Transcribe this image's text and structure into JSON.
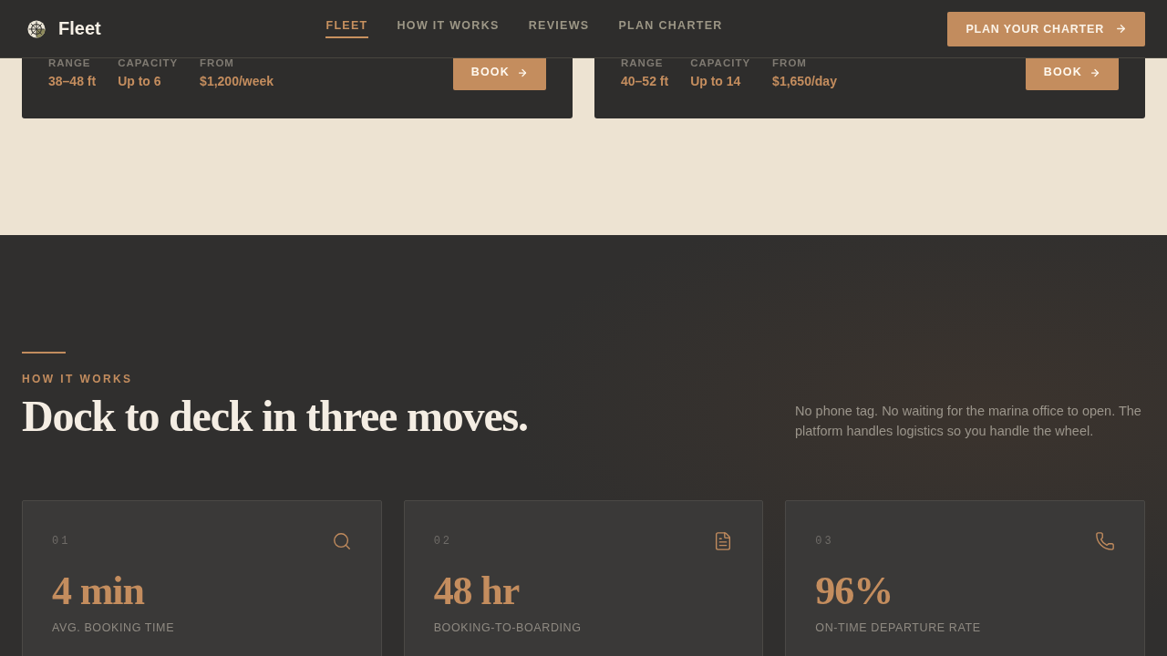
{
  "header": {
    "brand": "Fleet",
    "nav": [
      {
        "label": "FLEET",
        "selected": true
      },
      {
        "label": "HOW IT WORKS",
        "selected": false
      },
      {
        "label": "REVIEWS",
        "selected": false
      },
      {
        "label": "PLAN CHARTER",
        "selected": false
      }
    ],
    "cta": "PLAN YOUR CHARTER"
  },
  "fleet_cards": [
    {
      "specs": [
        {
          "label": "RANGE",
          "value": "38–48 ft"
        },
        {
          "label": "CAPACITY",
          "value": "Up to 6"
        },
        {
          "label": "FROM",
          "value": "$1,200/week"
        }
      ],
      "button": "BOOK"
    },
    {
      "specs": [
        {
          "label": "RANGE",
          "value": "40–52 ft"
        },
        {
          "label": "CAPACITY",
          "value": "Up to 14"
        },
        {
          "label": "FROM",
          "value": "$1,650/day"
        }
      ],
      "button": "BOOK"
    }
  ],
  "how_it_works": {
    "eyebrow": "HOW IT WORKS",
    "title": "Dock to deck in three moves.",
    "description": "No phone tag. No waiting for the marina office to open. The platform handles logistics so you handle the wheel.",
    "steps": [
      {
        "number": "01",
        "kind": "search",
        "value": "4 min",
        "label": "AVG. BOOKING TIME"
      },
      {
        "number": "02",
        "kind": "document",
        "value": "48 hr",
        "label": "BOOKING-TO-BOARDING"
      },
      {
        "number": "03",
        "kind": "phone",
        "value": "96%",
        "label": "ON-TIME DEPARTURE RATE"
      }
    ]
  }
}
